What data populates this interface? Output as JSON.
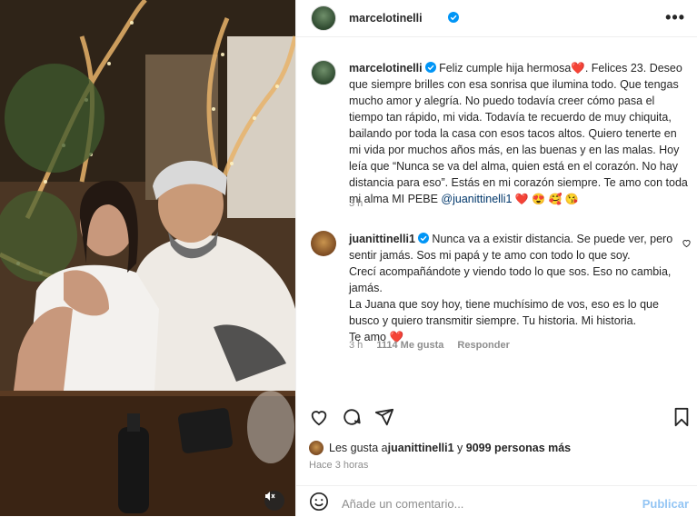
{
  "post_image": {
    "alt": ""
  },
  "header": {
    "username": "marcelotinelli",
    "more": "•••"
  },
  "caption": {
    "username": "marcelotinelli",
    "text_before_mention": "Feliz cumple hija hermosa❤️. Felices 23. Deseo que siempre brilles con esa sonrisa que ilumina todo. Que tengas mucho amor y alegría. No puedo todavía creer cómo pasa el tiempo tan rápido, mi vida. Todavía te recuerdo de muy chiquita, bailando por toda la casa con esos tacos altos. Quiero tenerte en mi vida por muchos años más, en las buenas y en las malas. Hoy leía que “Nunca se va del alma, quien está en el corazón. No hay distancia para eso”. Estás en mi corazón siempre. Te amo con toda mi alma MI PEBE",
    "mention": "@juanittinelli1",
    "emojis": "❤️ 😍 🥰 😘",
    "time": "3 h"
  },
  "reply": {
    "username": "juanittinelli1",
    "lines": [
      "Nunca va a existir distancia. Se puede ver, pero sentir jamás. Sos mi papá y te amo con todo lo que soy.",
      "Crecí acompañándote y viendo todo lo que sos. Eso no cambia, jamás.",
      "La Juana que soy hoy, tiene muchísimo de vos, eso es lo que busco y quiero transmitir siempre. Tu historia. Mi historia.",
      "Te amo ❤️"
    ],
    "time": "3 h",
    "likes": "1114 Me gusta",
    "reply_label": "Responder"
  },
  "likes": {
    "prefix": "Les gusta a ",
    "user": "juanittinelli1",
    "connector": " y ",
    "others": "9099 personas más"
  },
  "posted": "Hace 3 horas",
  "comment_box": {
    "placeholder": "Añade un comentario...",
    "publish": "Publicar"
  }
}
